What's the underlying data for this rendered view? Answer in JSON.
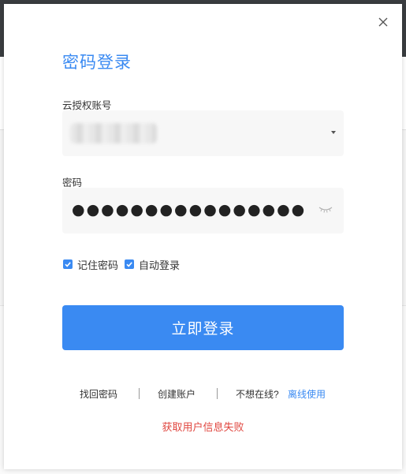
{
  "dialog": {
    "title": "密码登录",
    "close_icon": "close-icon"
  },
  "account": {
    "label": "云授权账号",
    "value": "",
    "dropdown_icon": "caret-down-icon"
  },
  "password": {
    "label": "密码",
    "masked_value": "●●●●●●●●●●●●●●●●",
    "toggle_icon": "eye-closed-icon"
  },
  "options": {
    "remember_password": {
      "label": "记住密码",
      "checked": true
    },
    "auto_login": {
      "label": "自动登录",
      "checked": true
    }
  },
  "login_button": "立即登录",
  "links": {
    "recover": "找回密码",
    "create": "创建账户",
    "offline_question": "不想在线?",
    "offline_action": "离线使用"
  },
  "error": "获取用户信息失败",
  "colors": {
    "accent": "#3a8af2",
    "error": "#e0463f"
  }
}
